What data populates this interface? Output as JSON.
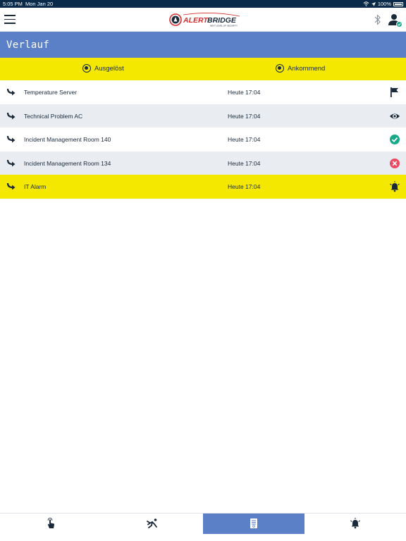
{
  "status_bar": {
    "time": "5:05 PM",
    "date": "Mon Jan 20",
    "battery": "100%"
  },
  "header": {
    "logo_text": "ALERTBRIDGE",
    "logo_tagline": "NEXT LEVEL OF SECURITY"
  },
  "page": {
    "title": "Verlauf"
  },
  "filters": [
    {
      "label": "Ausgelöst",
      "selected": true
    },
    {
      "label": "Ankommend",
      "selected": true
    }
  ],
  "alarms": [
    {
      "name": "Temperature Server",
      "time": "Heute 17:04",
      "status_icon": "flag-icon",
      "row_color": "#ffffff"
    },
    {
      "name": "Technical Problem AC",
      "time": "Heute 17:04",
      "status_icon": "eye-icon",
      "row_color": "#e9ecf0"
    },
    {
      "name": "Incident Management Room 140",
      "time": "Heute 17:04",
      "status_icon": "check-circle-icon",
      "row_color": "#ffffff"
    },
    {
      "name": "Incident Management Room 134",
      "time": "Heute 17:04",
      "status_icon": "cancel-circle-icon",
      "row_color": "#e9ecf0"
    },
    {
      "name": "IT Alarm",
      "time": "Heute 17:04",
      "status_icon": "alarm-bell-icon",
      "row_color": "#f4e800"
    }
  ],
  "bottom_nav": [
    {
      "icon": "touch-hand-icon",
      "active": false
    },
    {
      "icon": "man-down-icon",
      "active": false
    },
    {
      "icon": "history-document-icon",
      "active": true
    },
    {
      "icon": "alarm-bell-icon",
      "active": false
    }
  ],
  "colors": {
    "primary": "#5b80c7",
    "highlight": "#f4e800",
    "dark": "#1a2a3a",
    "success": "#17a88a",
    "danger": "#ec4a63",
    "logo_red": "#d62b2b"
  }
}
